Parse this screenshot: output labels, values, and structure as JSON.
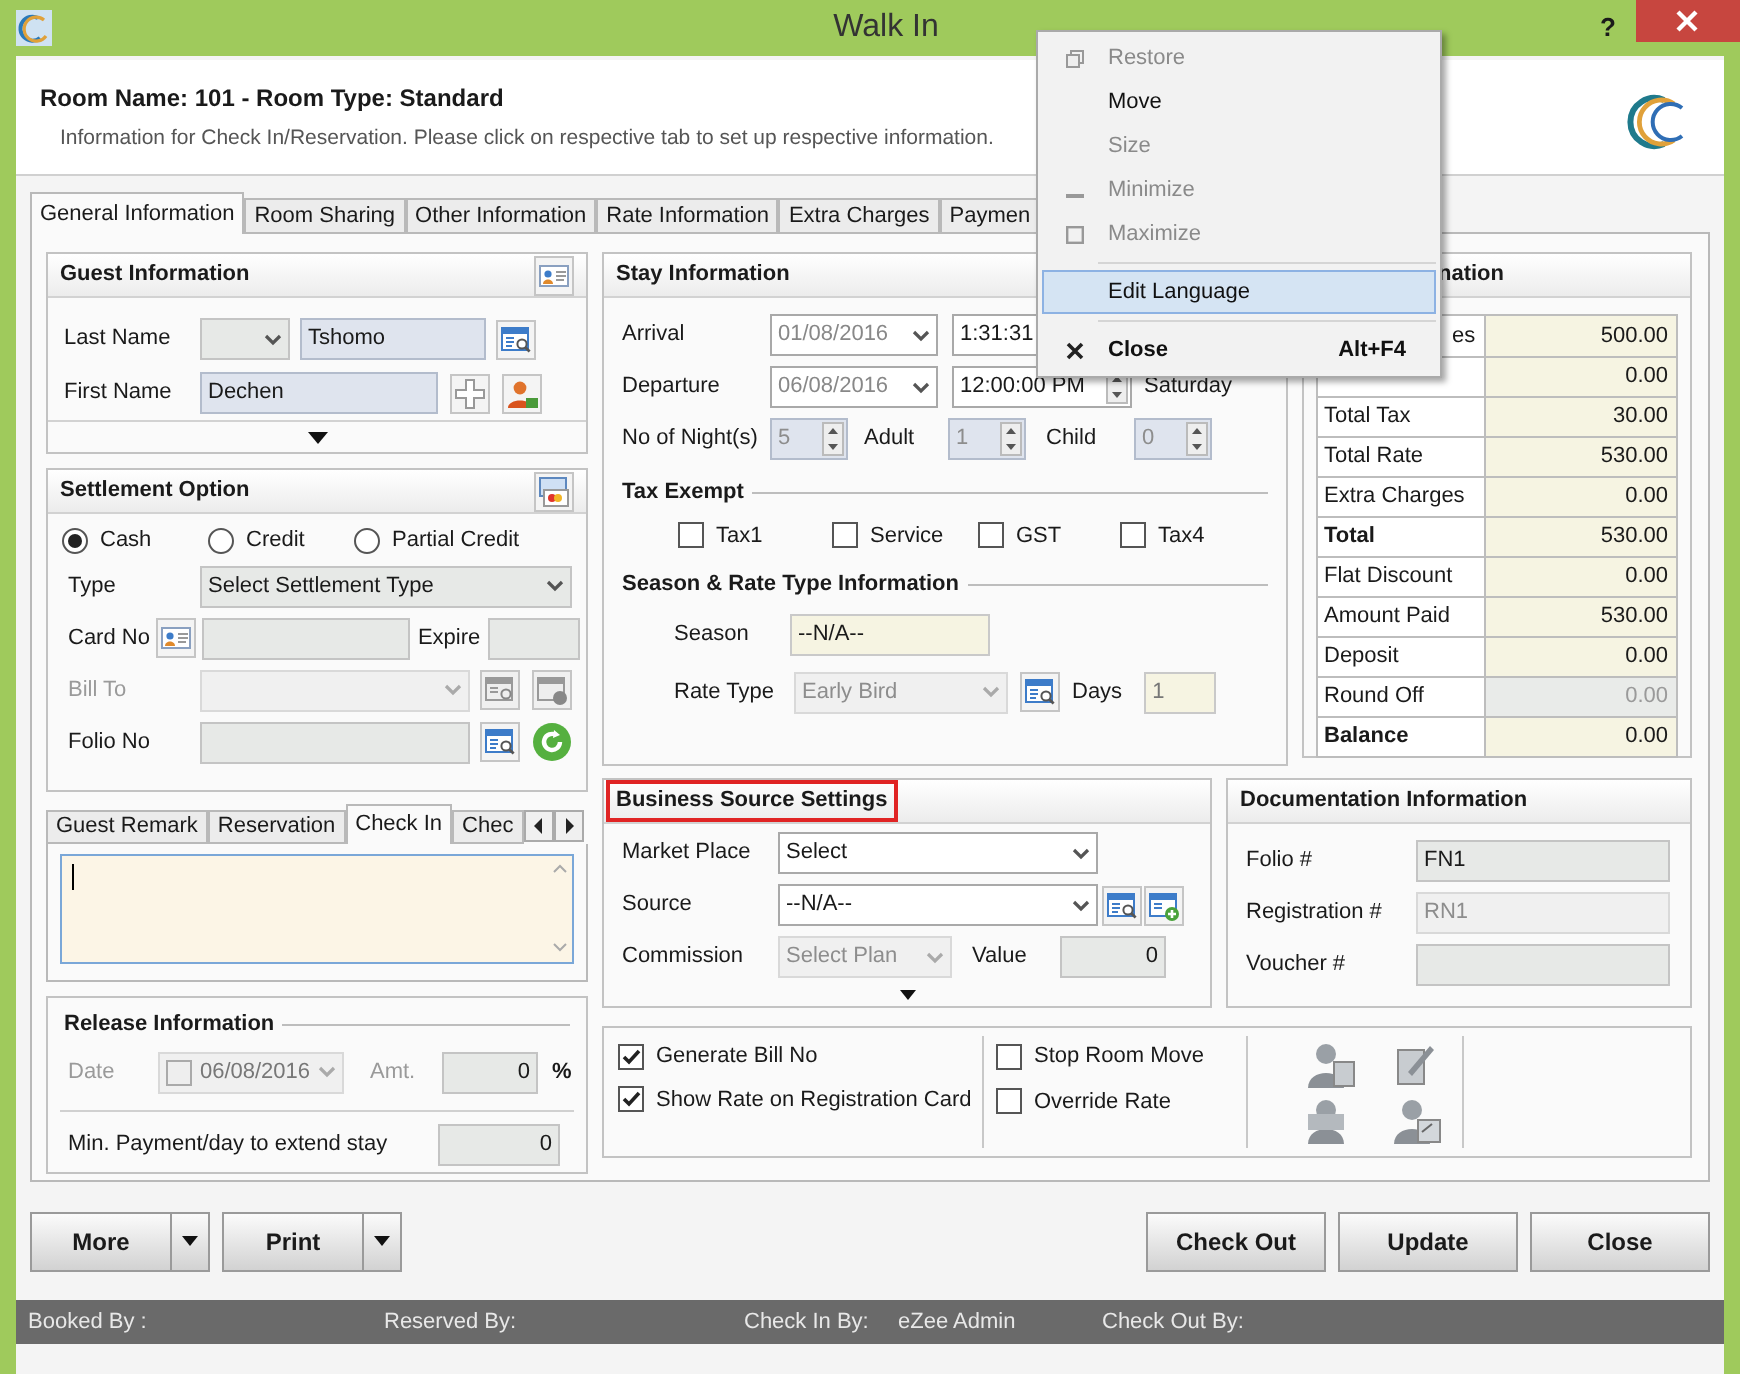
{
  "window": {
    "title": "Walk In",
    "help": "?"
  },
  "header": {
    "title": "Room Name: 101 - Room Type: Standard",
    "subtitle": "Information for Check In/Reservation. Please click on respective tab to set up respective information."
  },
  "tabs": [
    {
      "label": "General Information",
      "selected": true
    },
    {
      "label": "Room Sharing",
      "selected": false
    },
    {
      "label": "Other Information",
      "selected": false
    },
    {
      "label": "Rate Information",
      "selected": false
    },
    {
      "label": "Extra Charges",
      "selected": false
    },
    {
      "label": "Paymen",
      "selected": false
    }
  ],
  "guest_information": {
    "title": "Guest Information",
    "last_name_label": "Last Name",
    "last_name": "Tshomo",
    "first_name_label": "First Name",
    "first_name": "Dechen"
  },
  "settlement_option": {
    "title": "Settlement Option",
    "modes": [
      {
        "label": "Cash",
        "selected": true
      },
      {
        "label": "Credit",
        "selected": false
      },
      {
        "label": "Partial Credit",
        "selected": false
      }
    ],
    "type_label": "Type",
    "type": "Select Settlement Type",
    "card_no_label": "Card No",
    "expire_label": "Expire",
    "bill_to_label": "Bill To",
    "folio_no_label": "Folio No"
  },
  "remark_tabs": [
    {
      "label": "Guest Remark",
      "selected": false
    },
    {
      "label": "Reservation",
      "selected": false
    },
    {
      "label": "Check In",
      "selected": true
    },
    {
      "label": "Chec",
      "selected": false
    }
  ],
  "release_information": {
    "title": "Release Information",
    "date_label": "Date",
    "date_checked": false,
    "date": "06/08/2016",
    "amount_label": "Amt.",
    "amount": "0",
    "unit": "%",
    "min_payment_label": "Min. Payment/day to extend stay",
    "min_payment": "0"
  },
  "stay_information": {
    "title": "Stay Information",
    "arrival_label": "Arrival",
    "arrival_date": "01/08/2016",
    "arrival_time": "1:31:31",
    "departure_label": "Departure",
    "departure_date": "06/08/2016",
    "departure_time": "12:00:00 PM",
    "departure_day": "Saturday",
    "nights_label": "No of Night(s)",
    "nights": "5",
    "adult_label": "Adult",
    "adult": "1",
    "child_label": "Child",
    "child": "0",
    "tax_exempt_title": "Tax Exempt",
    "tax_exempt": [
      {
        "label": "Tax1",
        "checked": false
      },
      {
        "label": "Service",
        "checked": false
      },
      {
        "label": "GST",
        "checked": false
      },
      {
        "label": "Tax4",
        "checked": false
      }
    ],
    "season_title": "Season & Rate Type Information",
    "season_label": "Season",
    "season": "--N/A--",
    "rate_type_label": "Rate Type",
    "rate_type": "Early Bird",
    "days_label": "Days",
    "days": "1"
  },
  "rate_information": {
    "title": "nation",
    "rows": [
      {
        "label": "es",
        "value": "500.00",
        "bold": false,
        "disabled": false
      },
      {
        "value": "0.00",
        "disabled": false
      },
      {
        "label": "Total Tax",
        "value": "30.00",
        "bold": false,
        "disabled": false
      },
      {
        "label": "Total Rate",
        "value": "530.00",
        "bold": false,
        "disabled": false
      },
      {
        "label": "Extra Charges",
        "value": "0.00",
        "bold": false,
        "disabled": false
      },
      {
        "label": "Total",
        "value": "530.00",
        "bold": true,
        "disabled": false
      },
      {
        "label": "Flat Discount",
        "value": "0.00",
        "bold": false,
        "disabled": false
      },
      {
        "label": "Amount Paid",
        "value": "530.00",
        "bold": false,
        "disabled": false
      },
      {
        "label": "Deposit",
        "value": "0.00",
        "bold": false,
        "disabled": false
      },
      {
        "label": "Round Off",
        "value": "0.00",
        "bold": false,
        "disabled": true
      },
      {
        "label": "Balance",
        "value": "0.00",
        "bold": true,
        "disabled": false
      }
    ]
  },
  "business_source": {
    "title": "Business Source Settings",
    "highlighted": true,
    "market_place_label": "Market Place",
    "market_place": "Select",
    "source_label": "Source",
    "source": "--N/A--",
    "commission_label": "Commission",
    "commission": "Select Plan",
    "value_label": "Value",
    "value": "0"
  },
  "documentation": {
    "title": "Documentation Information",
    "rows": [
      {
        "label": "Folio #",
        "value": "FN1",
        "disabled": false
      },
      {
        "label": "Registration #",
        "value": "RN1",
        "disabled": true
      },
      {
        "label": "Voucher #",
        "value": "",
        "disabled": false
      }
    ]
  },
  "options": [
    {
      "label": "Generate Bill No",
      "checked": true
    },
    {
      "label": "Show Rate on Registration Card",
      "checked": true
    },
    {
      "label": "Stop Room Move",
      "checked": false
    },
    {
      "label": "Override Rate",
      "checked": false
    }
  ],
  "buttons_left": [
    {
      "label": "More"
    },
    {
      "label": "Print"
    }
  ],
  "buttons_right": [
    {
      "label": "Check Out"
    },
    {
      "label": "Update"
    },
    {
      "label": "Close"
    }
  ],
  "status_bar": {
    "booked_by": "Booked By :",
    "reserved_by": "Reserved By:",
    "check_in_by": "Check In By:",
    "check_in_user": "eZee Admin",
    "check_out_by": "Check Out By:"
  },
  "system_menu": [
    {
      "kind": "item",
      "label": "Restore",
      "disabled": true,
      "selected": false
    },
    {
      "kind": "item",
      "label": "Move",
      "disabled": false,
      "selected": false
    },
    {
      "kind": "item",
      "label": "Size",
      "disabled": true,
      "selected": false
    },
    {
      "kind": "item",
      "label": "Minimize",
      "disabled": true,
      "selected": false
    },
    {
      "kind": "item",
      "label": "Maximize",
      "disabled": true,
      "selected": false
    },
    {
      "kind": "separator"
    },
    {
      "kind": "item",
      "label": "Edit Language",
      "disabled": false,
      "selected": true
    },
    {
      "kind": "separator"
    },
    {
      "kind": "item",
      "label": "Close",
      "shortcut": "Alt+F4",
      "disabled": false,
      "selected": false
    }
  ]
}
